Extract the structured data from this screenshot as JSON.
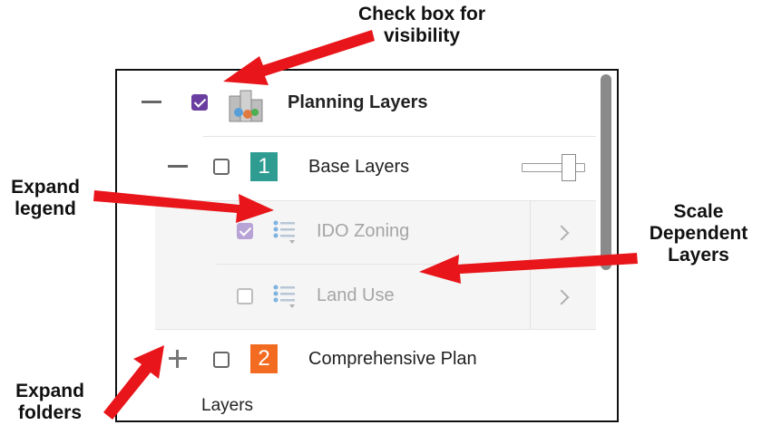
{
  "annotations": {
    "checkbox_visibility_line1": "Check box for",
    "checkbox_visibility_line2": "visibility",
    "expand_legend_line1": "Expand",
    "expand_legend_line2": "legend",
    "scale_dependent_line1": "Scale",
    "scale_dependent_line2": "Dependent",
    "scale_dependent_line3": "Layers",
    "expand_folders_line1": "Expand",
    "expand_folders_line2": "folders"
  },
  "layers": {
    "planning": {
      "label": "Planning Layers",
      "checked": true
    },
    "base": {
      "number": "1",
      "label": "Base Layers",
      "checked": false,
      "color": "#2f9c92"
    },
    "ido_zoning": {
      "label": "IDO Zoning",
      "checked": true,
      "scale_dependent": true
    },
    "land_use": {
      "label": "Land Use",
      "checked": false,
      "scale_dependent": true
    },
    "comprehensive": {
      "number": "2",
      "label": "Comprehensive Plan",
      "checked": false,
      "color": "#f26b21"
    }
  },
  "footer": {
    "label": "Layers"
  },
  "colors": {
    "accent": "#6a3ea1",
    "arrow": "#e8161b"
  }
}
